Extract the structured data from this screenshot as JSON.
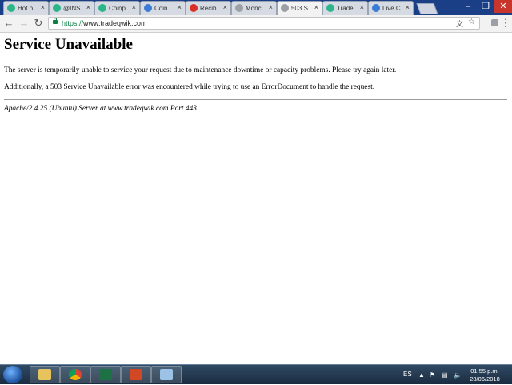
{
  "browser": {
    "tabs": [
      {
        "label": "Hot p",
        "favicon_color": "#2db58a",
        "active": false
      },
      {
        "label": "@INS",
        "favicon_color": "#2db58a",
        "active": false
      },
      {
        "label": "Coinp",
        "favicon_color": "#2db58a",
        "active": false
      },
      {
        "label": "Coin",
        "favicon_color": "#3a7bd5",
        "active": false
      },
      {
        "label": "Recib",
        "favicon_color": "#d93025",
        "active": false
      },
      {
        "label": "Monc",
        "favicon_color": "#9aa0a6",
        "active": false
      },
      {
        "label": "503 S",
        "favicon_color": "#9aa0a6",
        "active": true
      },
      {
        "label": "Trade",
        "favicon_color": "#2db58a",
        "active": false
      },
      {
        "label": "Live C",
        "favicon_color": "#3a7bd5",
        "active": false
      }
    ],
    "url_scheme": "https://",
    "url_host": "www.tradeqwik.com"
  },
  "page": {
    "title": "Service Unavailable",
    "paragraph1": "The server is temporarily unable to service your request due to maintenance downtime or capacity problems. Please try again later.",
    "paragraph2": "Additionally, a 503 Service Unavailable error was encountered while trying to use an ErrorDocument to handle the request.",
    "address": "Apache/2.4.25 (Ubuntu) Server at www.tradeqwik.com Port 443"
  },
  "taskbar": {
    "language": "ES",
    "time": "01:55 p.m.",
    "date": "28/06/2018",
    "apps": [
      "file-explorer-icon",
      "chrome-icon",
      "excel-icon",
      "powerpoint-icon",
      "window-app-icon"
    ]
  },
  "colors": {
    "titlebar": "#1b3f86",
    "secure_green": "#0b8043"
  }
}
